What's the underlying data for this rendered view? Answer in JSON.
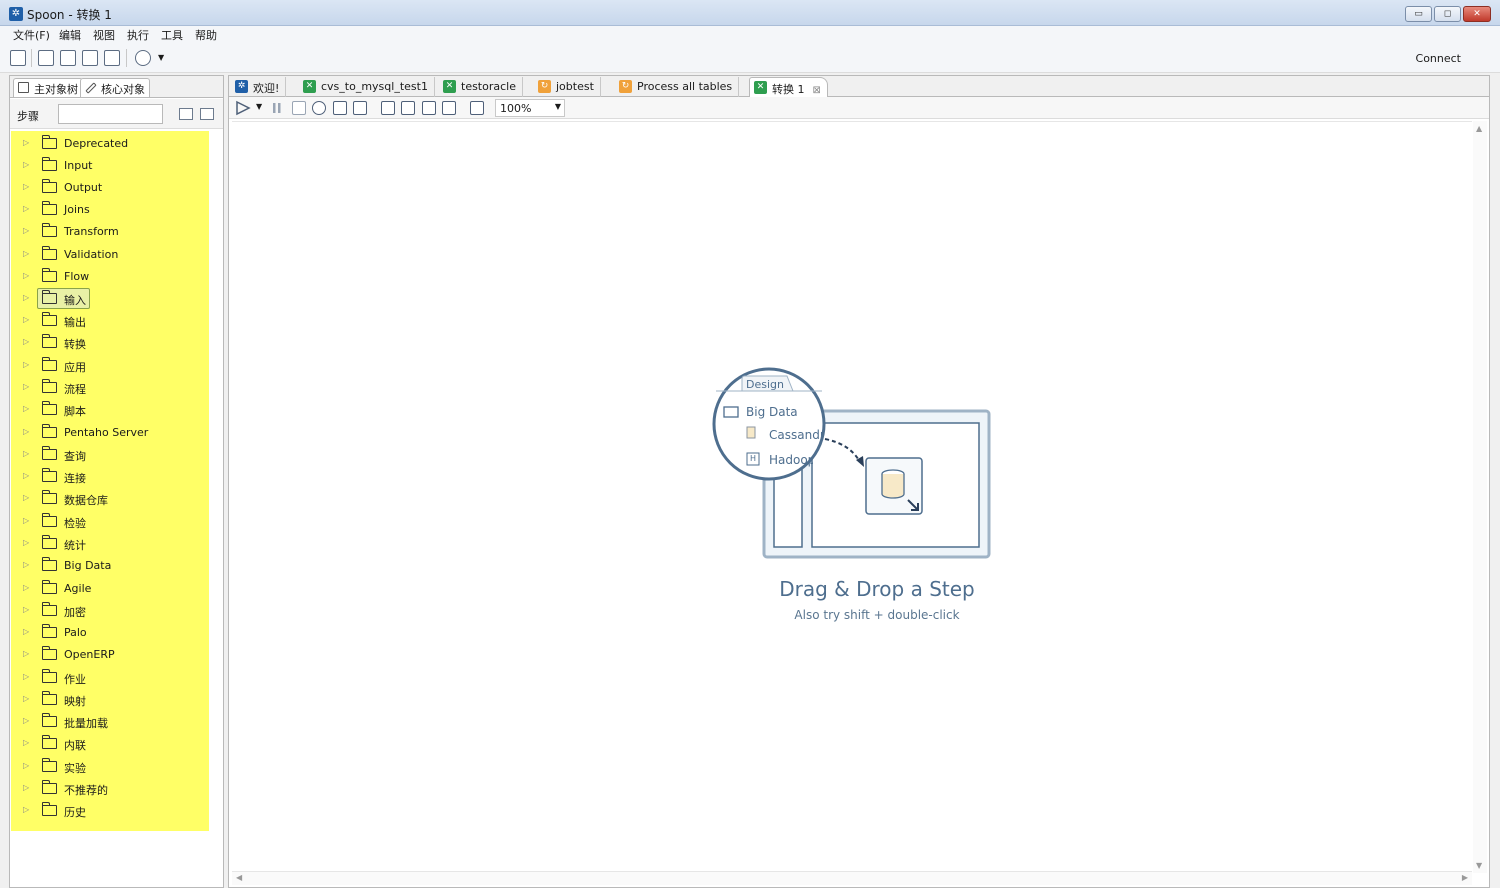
{
  "window": {
    "title": "Spoon - 转换 1",
    "minimize": "▭",
    "maximize": "◻",
    "close": "✕"
  },
  "menu": [
    "文件(F)",
    "编辑",
    "视图",
    "执行",
    "工具",
    "帮助"
  ],
  "toolbar": {
    "connect_label": "Connect"
  },
  "left_panel": {
    "tabs": [
      "主对象树",
      "核心对象"
    ],
    "search_label": "步骤",
    "search_value": "",
    "tree_items": [
      "Deprecated",
      "Input",
      "Output",
      "Joins",
      "Transform",
      "Validation",
      "Flow",
      "输入",
      "输出",
      "转换",
      "应用",
      "流程",
      "脚本",
      "Pentaho Server",
      "查询",
      "连接",
      "数据仓库",
      "检验",
      "统计",
      "Big Data",
      "Agile",
      "加密",
      "Palo",
      "OpenERP",
      "作业",
      "映射",
      "批量加载",
      "内联",
      "实验",
      "不推荐的",
      "历史"
    ],
    "selected_item": "输入"
  },
  "editor": {
    "tabs": [
      {
        "label": "欢迎!",
        "icon": "spoon-icon"
      },
      {
        "label": "cvs_to_mysql_test1",
        "icon": "transformation-icon"
      },
      {
        "label": "testoracle",
        "icon": "transformation-icon"
      },
      {
        "label": "jobtest",
        "icon": "job-icon"
      },
      {
        "label": "Process all tables",
        "icon": "job-icon"
      },
      {
        "label": "转换 1",
        "icon": "transformation-icon"
      }
    ],
    "active_tab": "转换 1",
    "zoom": "100%"
  },
  "canvas_hint": {
    "design_tab": "Design",
    "folder_label": "Big Data",
    "item1": "Cassandr",
    "item2": "Hadoop",
    "item2_badge": "H",
    "title": "Drag & Drop a Step",
    "subtitle": "Also try shift + double-click"
  },
  "colors": {
    "tree_highlight": "#ffff66",
    "hint_blue": "#4e6e8e"
  }
}
